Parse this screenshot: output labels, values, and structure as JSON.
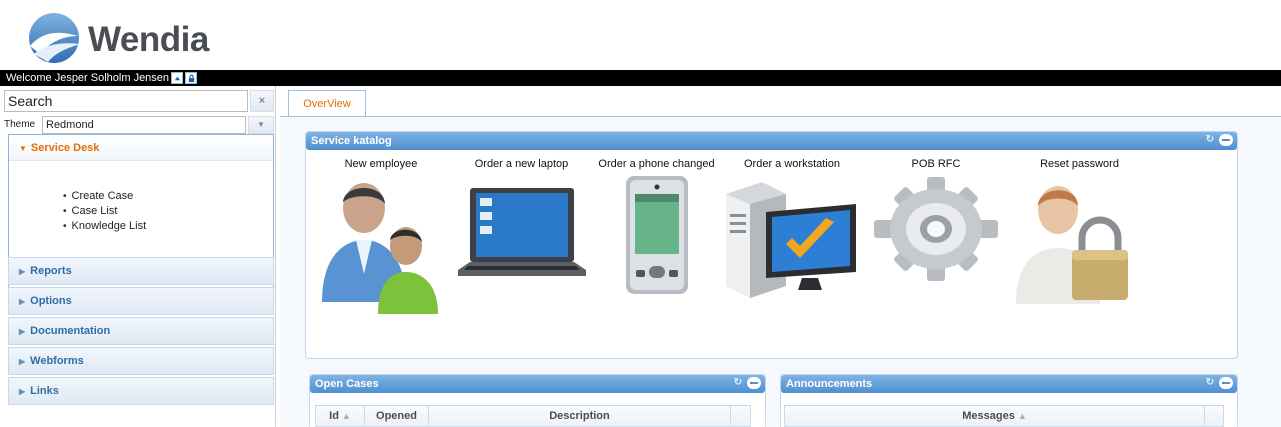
{
  "app": {
    "logo_text": "Wendia",
    "welcome_text": "Welcome Jesper Solholm Jensen",
    "up_button_icon": "arrow-up-icon",
    "lock_button_icon": "lock-icon"
  },
  "sidebar": {
    "search_value": "Search",
    "clear_icon": "×",
    "theme_label": "Theme",
    "theme_value": "Redmond",
    "theme_arrow": "▼",
    "open_section": {
      "title": "Service Desk",
      "items": [
        "Create Case",
        "Case List",
        "Knowledge List"
      ]
    },
    "sections": [
      {
        "label": "Reports"
      },
      {
        "label": "Options"
      },
      {
        "label": "Documentation"
      },
      {
        "label": "Webforms"
      },
      {
        "label": "Links"
      }
    ]
  },
  "tabs": [
    {
      "label": "OverView",
      "active": true
    }
  ],
  "service_katalog": {
    "title": "Service katalog",
    "items": [
      {
        "label": "New employee",
        "icon": "users-icon"
      },
      {
        "label": "Order a new laptop",
        "icon": "laptop-icon"
      },
      {
        "label": "Order a phone changed",
        "icon": "phone-icon"
      },
      {
        "label": "Order a workstation",
        "icon": "workstation-icon"
      },
      {
        "label": "POB RFC",
        "icon": "gear-icon"
      },
      {
        "label": "Reset password",
        "icon": "user-lock-icon"
      }
    ]
  },
  "open_cases": {
    "title": "Open Cases",
    "columns": [
      "Id",
      "Opened",
      "Description"
    ]
  },
  "announcements": {
    "title": "Announcements",
    "columns": [
      "Messages"
    ]
  },
  "colors": {
    "accent_orange": "#e17009",
    "header_blue": "#4f8fcf",
    "link_blue": "#2e6da4"
  }
}
